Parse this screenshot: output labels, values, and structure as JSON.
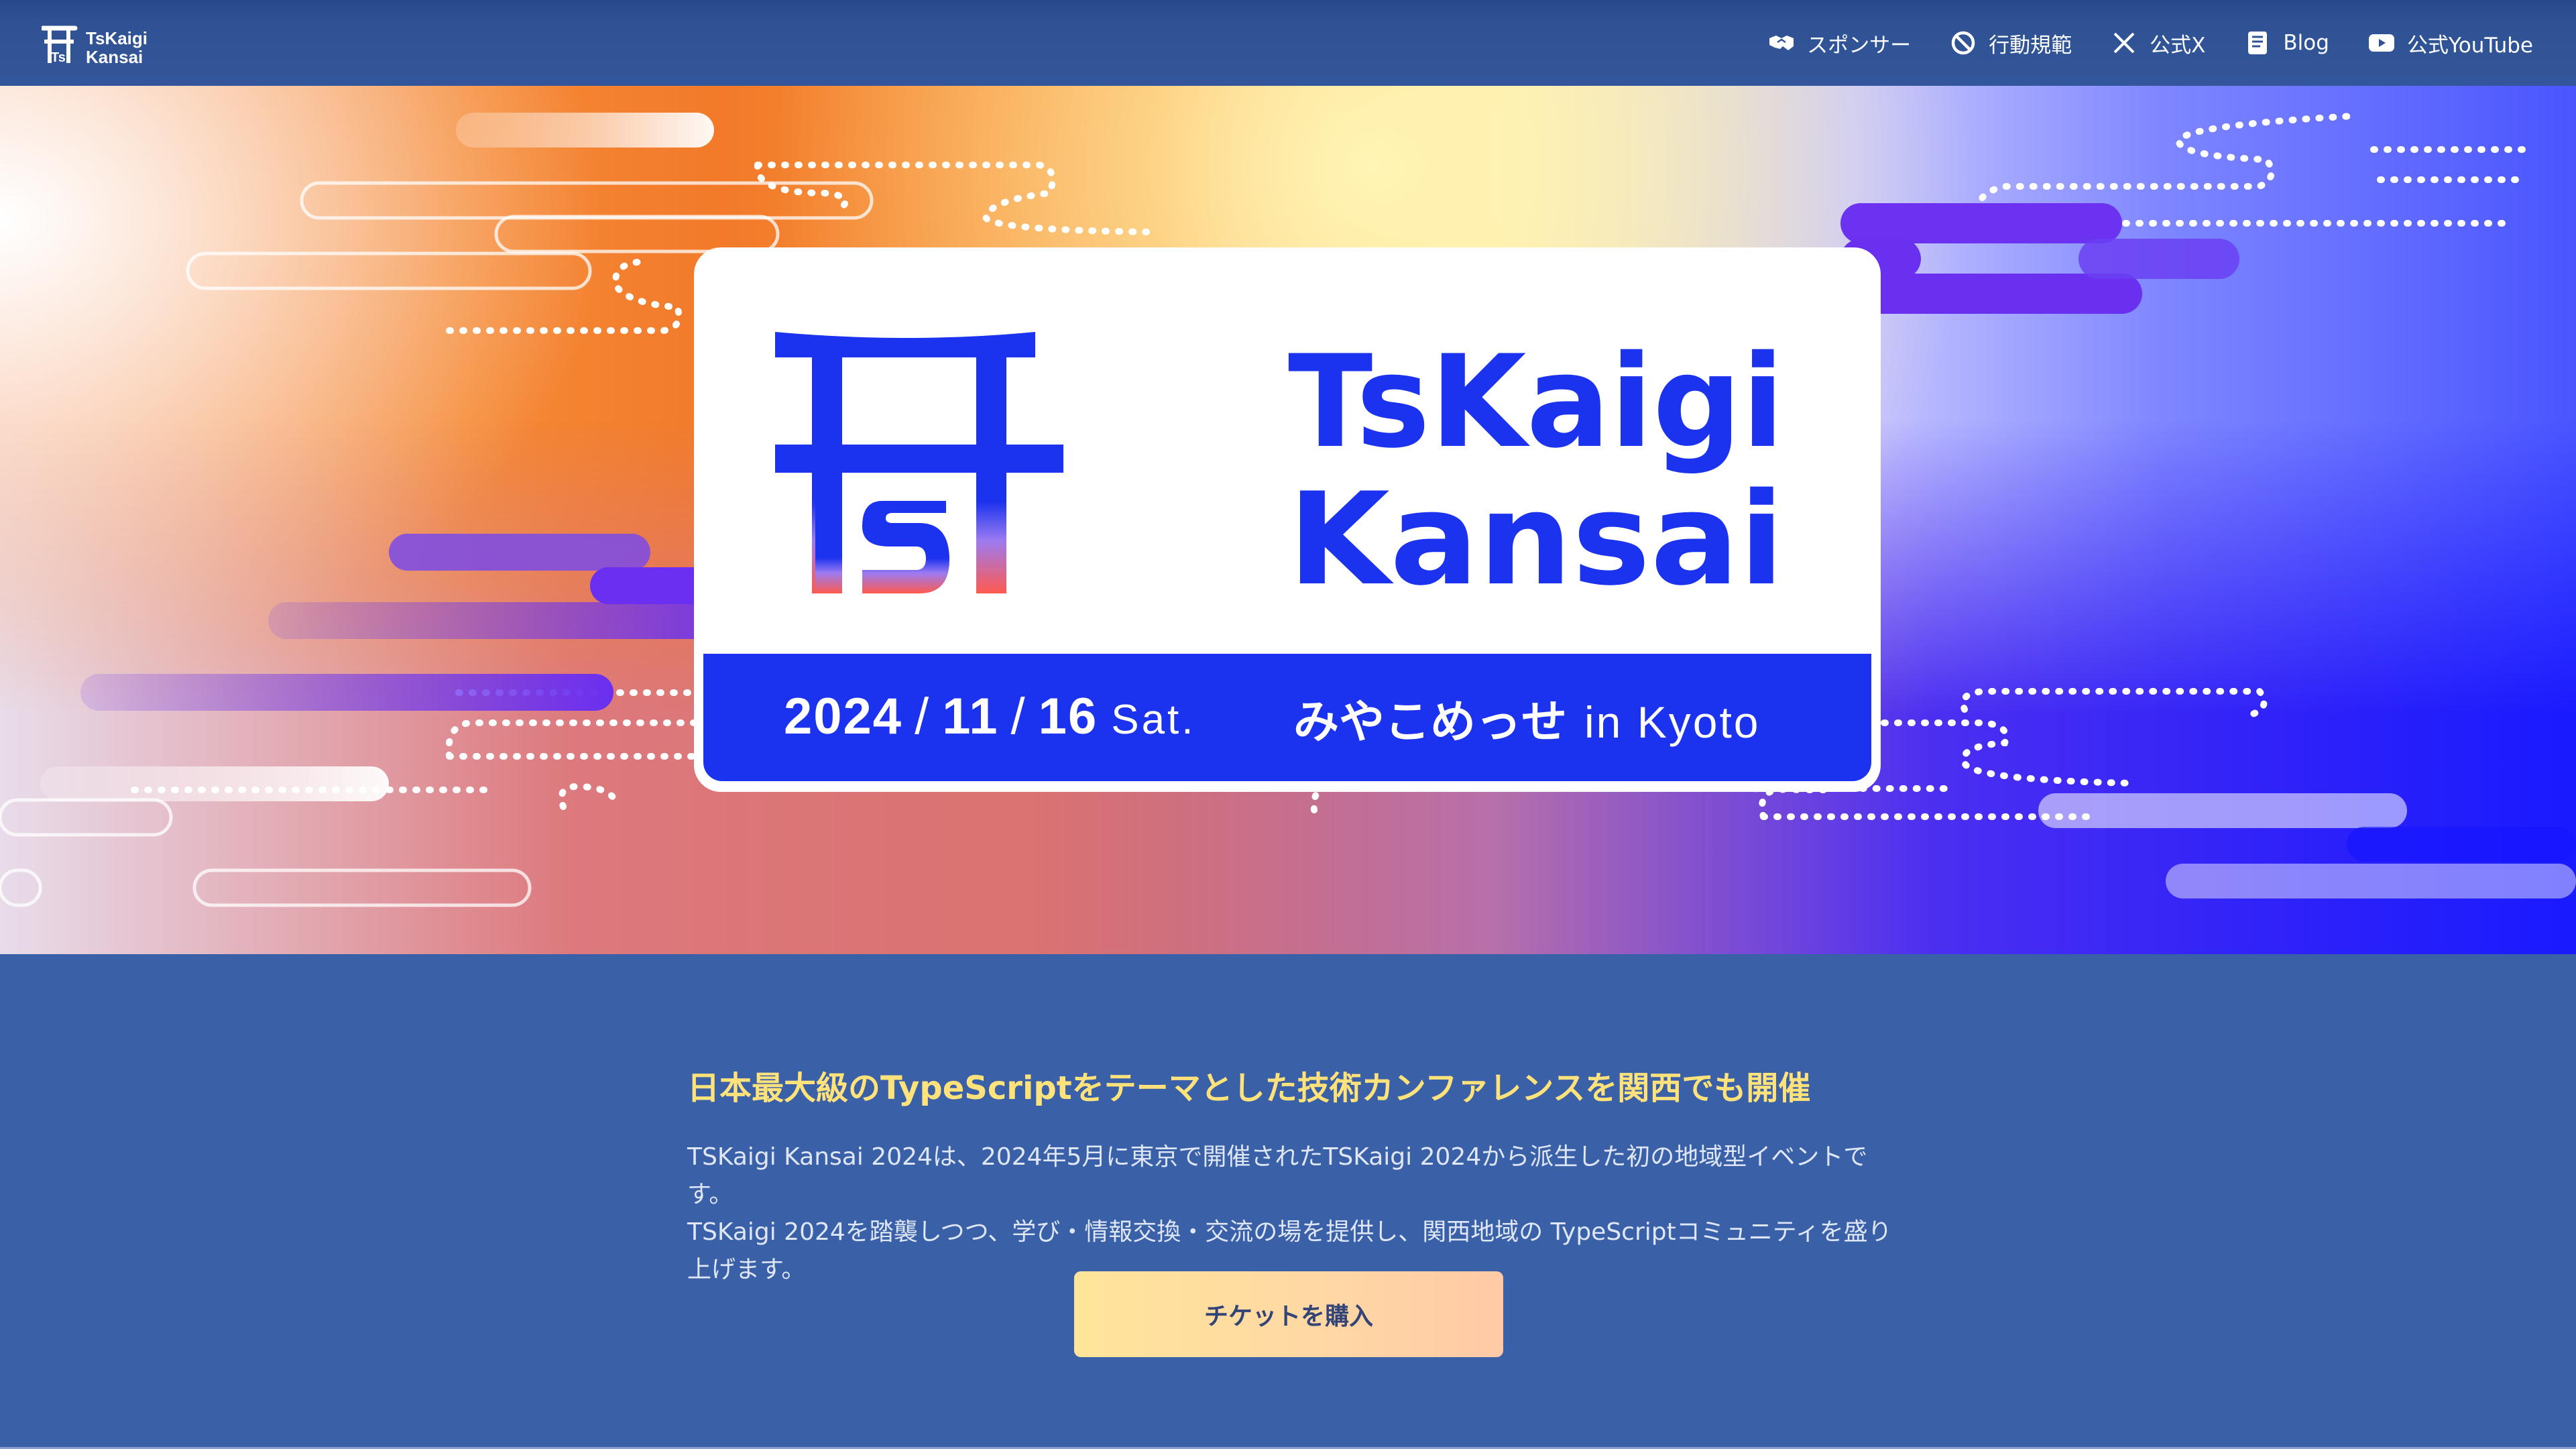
{
  "header": {
    "brand": {
      "line1": "TsKaigi",
      "line2": "Kansai"
    },
    "nav": [
      {
        "label": "スポンサー",
        "icon": "handshake-icon"
      },
      {
        "label": "行動規範",
        "icon": "ban-icon"
      },
      {
        "label": "公式X",
        "icon": "x-logo-icon"
      },
      {
        "label": "Blog",
        "icon": "book-icon"
      },
      {
        "label": "公式YouTube",
        "icon": "youtube-icon"
      }
    ]
  },
  "hero": {
    "wordmark": {
      "line1": "TsKaigi",
      "line2": "Kansai"
    },
    "date": {
      "year": "2024",
      "month": "11",
      "day": "16",
      "dow": "Sat."
    },
    "venue": {
      "name": "みやこめっせ",
      "location": "in Kyoto"
    }
  },
  "about": {
    "heading": "日本最大級のTypeScriptをテーマとした技術カンファレンスを関西でも開催",
    "body_lines": [
      "TSKaigi Kansai 2024は、2024年5月に東京で開催されたTSKaigi 2024から派生した初の地域型イベントです。",
      "TSKaigi 2024を踏襲しつつ、学び・情報交換・交流の場を提供し、関西地域の TypeScriptコミュニティを盛り",
      "上げます。"
    ],
    "cta_label": "チケットを購入"
  },
  "colors": {
    "header_bg": "#2f5294",
    "page_bg": "#3a60a8",
    "heading_yellow": "#ffe27a",
    "brand_blue": "#1b32ee"
  }
}
